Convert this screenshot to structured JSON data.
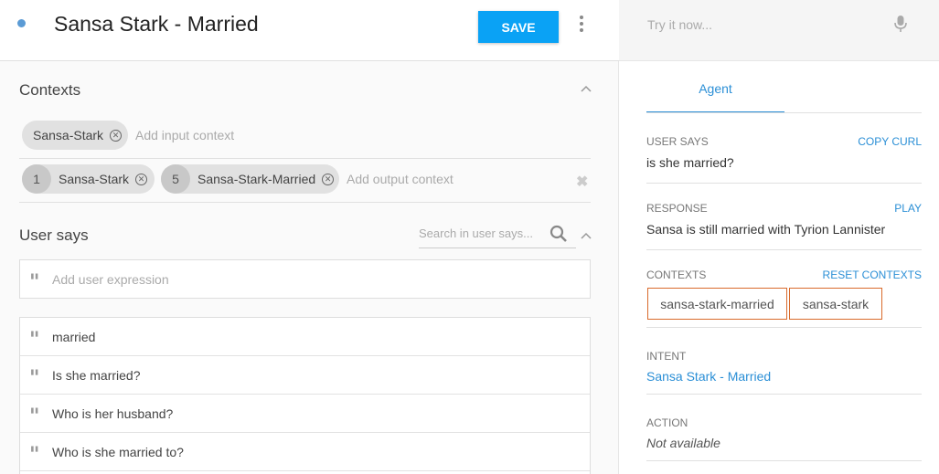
{
  "header": {
    "intent_name": "Sansa Stark - Married",
    "save_label": "SAVE"
  },
  "contexts": {
    "title": "Contexts",
    "input_contexts": [
      {
        "label": "Sansa-Stark"
      }
    ],
    "input_placeholder": "Add input context",
    "output_contexts": [
      {
        "lifespan": "1",
        "label": "Sansa-Stark"
      },
      {
        "lifespan": "5",
        "label": "Sansa-Stark-Married"
      }
    ],
    "output_placeholder": "Add output context"
  },
  "user_says": {
    "title": "User says",
    "search_placeholder": "Search in user says...",
    "add_placeholder": "Add user expression",
    "expressions": [
      "married",
      "Is she married?",
      "Who is her husband?",
      "Who is she married to?"
    ]
  },
  "console": {
    "try_placeholder": "Try it now...",
    "tab_label": "Agent",
    "user_says_label": "USER SAYS",
    "copy_curl_label": "COPY CURL",
    "user_says_value": "is she married?",
    "response_label": "RESPONSE",
    "play_label": "PLAY",
    "response_value": "Sansa is still married with Tyrion Lannister",
    "contexts_label": "CONTEXTS",
    "reset_contexts_label": "RESET CONTEXTS",
    "active_contexts": [
      "sansa-stark-married",
      "sansa-stark"
    ],
    "intent_label": "INTENT",
    "intent_value": "Sansa Stark - Married",
    "action_label": "ACTION",
    "action_value": "Not available"
  },
  "colors": {
    "accent": "#0aa2f5",
    "link": "#2b8fd6",
    "context_border": "#d96a2b"
  }
}
